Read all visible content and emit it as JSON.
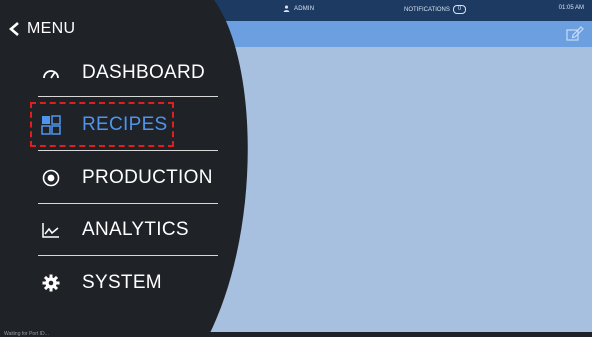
{
  "header": {
    "user_label": "ADMIN",
    "notifications_label": "NOTIFICATIONS",
    "notifications_count": "0",
    "time": "01:05 AM"
  },
  "menu": {
    "title": "MENU",
    "items": [
      {
        "label": "DASHBOARD",
        "icon": "speedometer-icon"
      },
      {
        "label": "RECIPES",
        "icon": "grid-blocks-icon",
        "selected": true
      },
      {
        "label": "PRODUCTION",
        "icon": "target-icon"
      },
      {
        "label": "ANALYTICS",
        "icon": "line-chart-icon"
      },
      {
        "label": "SYSTEM",
        "icon": "gear-icon"
      }
    ]
  },
  "status": {
    "text": "Waiting for Port ID..."
  },
  "colors": {
    "topbar": "#1d3a63",
    "subbar": "#6b9fe0",
    "content_bg": "#a7c0e0",
    "menu_bg": "#1f2226",
    "accent": "#4f94ee",
    "highlight": "#e11d1d"
  }
}
